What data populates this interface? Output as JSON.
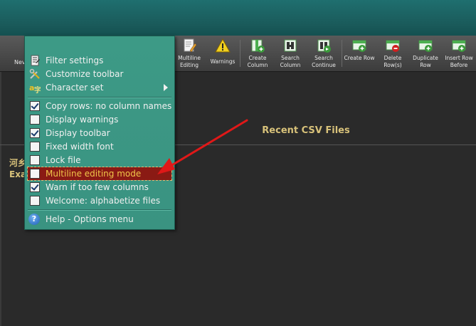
{
  "toolbar": {
    "new_fragment": "Nev",
    "buttons": [
      {
        "label": "Multiline Editing",
        "icon": "multiline-edit-icon"
      },
      {
        "label": "Warnings",
        "icon": "warning-icon"
      },
      {
        "label": "Create Column",
        "icon": "create-column-icon"
      },
      {
        "label": "Search Column",
        "icon": "search-column-icon"
      },
      {
        "label": "Search Continue",
        "icon": "search-continue-icon"
      },
      {
        "label": "Create Row",
        "icon": "create-row-icon"
      },
      {
        "label": "Delete Row(s)",
        "icon": "delete-row-icon"
      },
      {
        "label": "Duplicate Row",
        "icon": "duplicate-row-icon"
      },
      {
        "label": "Insert Row Before",
        "icon": "insert-row-before-icon"
      }
    ]
  },
  "main": {
    "recent_title": "Recent CSV Files",
    "side_text_1": "河乡",
    "side_text_2": "Exa"
  },
  "menu": {
    "items": [
      {
        "label": "Filter settings",
        "icon": "filter-settings-icon"
      },
      {
        "label": "Customize toolbar",
        "icon": "customize-toolbar-icon"
      },
      {
        "label": "Character set",
        "icon": "character-set-icon"
      },
      {
        "label": "Copy rows: no column names",
        "checked": true
      },
      {
        "label": "Display warnings",
        "checked": false
      },
      {
        "label": "Display toolbar",
        "checked": true
      },
      {
        "label": "Fixed width font",
        "checked": false
      },
      {
        "label": "Lock file",
        "checked": false
      },
      {
        "label": "Multiline editing mode",
        "checked": false
      },
      {
        "label": "Warn if too few columns",
        "checked": true
      },
      {
        "label": "Welcome: alphabetize files",
        "checked": false
      },
      {
        "label": "Help - Options menu",
        "icon": "help-icon"
      }
    ]
  },
  "colors": {
    "titlebar": "#1a5a5a",
    "menu_bg": "#3a9381",
    "highlight_bg": "#8a1a14",
    "highlight_text": "#f0c64a",
    "accent_text": "#d8c27a",
    "arrow": "#e01818"
  }
}
